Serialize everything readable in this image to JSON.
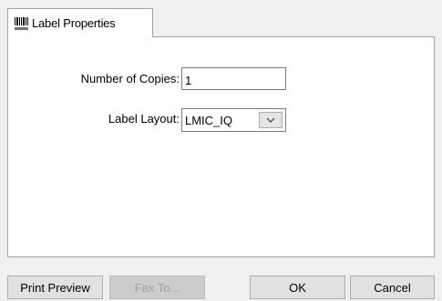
{
  "tab": {
    "label": "Label Properties",
    "icon": "barcode-icon"
  },
  "form": {
    "copies_label": "Number of Copies:",
    "copies_value": "1",
    "layout_label": "Label Layout:",
    "layout_value": "LMIC_IQ"
  },
  "buttons": {
    "print_preview": "Print Preview",
    "fax_to": "Fax To...",
    "ok": "OK",
    "cancel": "Cancel"
  }
}
